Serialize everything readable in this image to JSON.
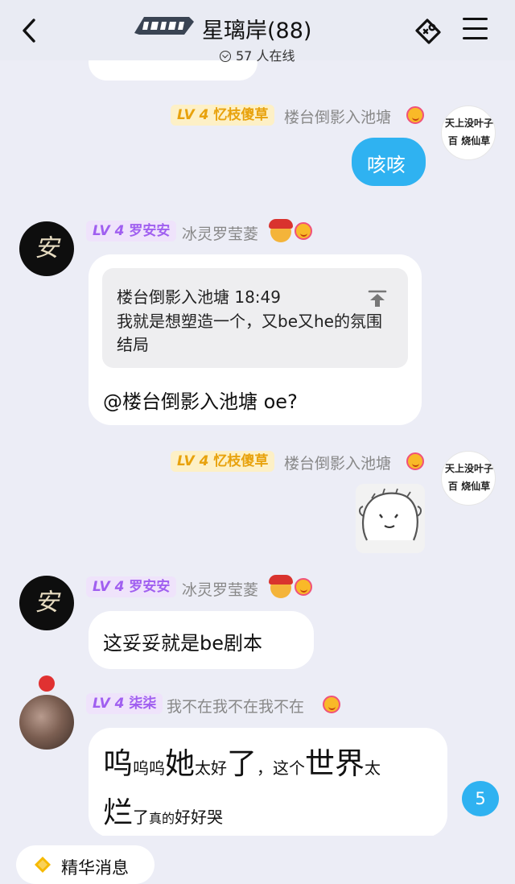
{
  "header": {
    "title": "星璃岸(88)",
    "online": "57 人在线",
    "logo_icon": "game-logo",
    "game_icon": "gamepad-icon",
    "menu_icon": "hamburger-menu-icon"
  },
  "messages": [
    {
      "side": "right",
      "level": "LV 4",
      "title": "忆枝傻草",
      "nickname": "楼台倒影入池塘",
      "text": "咳咳",
      "avatar_text": "天上没叶子百 烧仙草"
    },
    {
      "side": "left",
      "level": "LV 4",
      "title": "罗安安",
      "nickname": "冰灵罗莹菱",
      "avatar_text": "安",
      "quote": {
        "author": "楼台倒影入池塘",
        "time": "18:49",
        "text": "我就是想塑造一个，又be又he的氛围结局"
      },
      "text": "@楼台倒影入池塘 oe?"
    },
    {
      "side": "right",
      "level": "LV 4",
      "title": "忆枝傻草",
      "nickname": "楼台倒影入池塘",
      "sticker": "cartoon-face-sticker",
      "avatar_text": "天上没叶子百 烧仙草"
    },
    {
      "side": "left",
      "level": "LV 4",
      "title": "罗安安",
      "nickname": "冰灵罗莹菱",
      "avatar_text": "安",
      "text": "这妥妥就是be剧本"
    },
    {
      "side": "left",
      "level": "LV 4",
      "title": "柒柒",
      "nickname": "我不在我不在我不在",
      "text_parts": [
        "呜",
        "呜呜",
        "她",
        "太好",
        "了",
        "，这个",
        "世界",
        "太",
        "烂",
        "了",
        "真的",
        "好好哭"
      ]
    }
  ],
  "unread_count": "5",
  "essence_label": "精华消息",
  "colors": {
    "accent": "#2fb2f1",
    "gold_badge": "#e8a20c",
    "purple_badge": "#a05ff0",
    "background": "#ecedf6"
  }
}
